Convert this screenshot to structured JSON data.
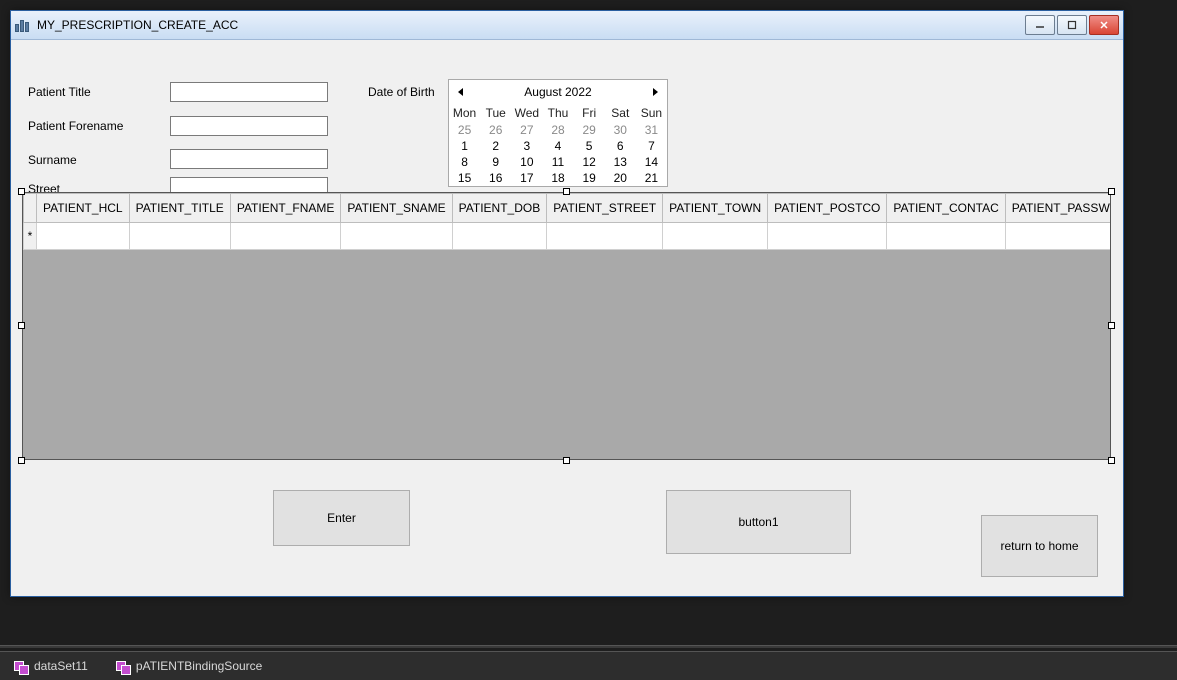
{
  "window": {
    "title": "MY_PRESCRIPTION_CREATE_ACC"
  },
  "form": {
    "labels": {
      "title": "Patient Title",
      "forename": "Patient Forename",
      "surname": "Surname",
      "street": "Street",
      "dob": "Date of Birth"
    },
    "values": {
      "title": "",
      "forename": "",
      "surname": "",
      "street": ""
    }
  },
  "calendar": {
    "month_label": "August 2022",
    "day_headers": [
      "Mon",
      "Tue",
      "Wed",
      "Thu",
      "Fri",
      "Sat",
      "Sun"
    ],
    "weeks": [
      [
        {
          "d": "25",
          "o": true
        },
        {
          "d": "26",
          "o": true
        },
        {
          "d": "27",
          "o": true
        },
        {
          "d": "28",
          "o": true
        },
        {
          "d": "29",
          "o": true
        },
        {
          "d": "30",
          "o": true
        },
        {
          "d": "31",
          "o": true
        }
      ],
      [
        {
          "d": "1"
        },
        {
          "d": "2"
        },
        {
          "d": "3"
        },
        {
          "d": "4"
        },
        {
          "d": "5"
        },
        {
          "d": "6"
        },
        {
          "d": "7"
        }
      ],
      [
        {
          "d": "8"
        },
        {
          "d": "9"
        },
        {
          "d": "10"
        },
        {
          "d": "11"
        },
        {
          "d": "12"
        },
        {
          "d": "13"
        },
        {
          "d": "14"
        }
      ],
      [
        {
          "d": "15"
        },
        {
          "d": "16"
        },
        {
          "d": "17"
        },
        {
          "d": "18"
        },
        {
          "d": "19"
        },
        {
          "d": "20"
        },
        {
          "d": "21"
        }
      ]
    ]
  },
  "grid": {
    "columns": [
      "PATIENT_HCL",
      "PATIENT_TITLE",
      "PATIENT_FNAME",
      "PATIENT_SNAME",
      "PATIENT_DOB",
      "PATIENT_STREET",
      "PATIENT_TOWN",
      "PATIENT_POSTCO",
      "PATIENT_CONTAC",
      "PATIENT_PASSWO"
    ],
    "new_row_marker": "*"
  },
  "buttons": {
    "enter": "Enter",
    "button1": "button1",
    "return_home": "return to home"
  },
  "tray": {
    "items": [
      "dataSet11",
      "pATIENTBindingSource"
    ]
  }
}
